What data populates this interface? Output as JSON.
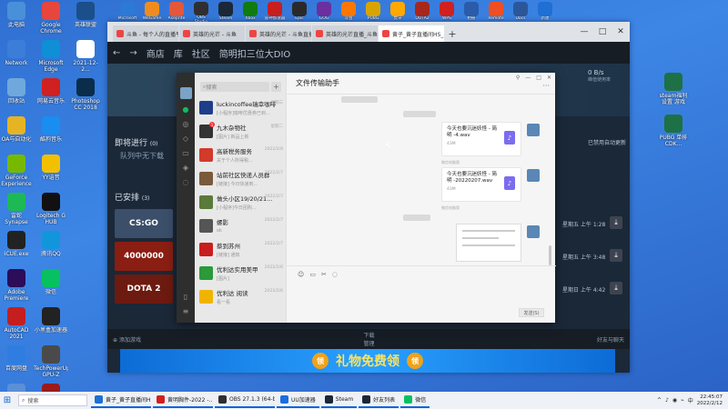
{
  "desktop": {
    "left_col1": [
      {
        "label": "此电脑",
        "icon": "computer-icon",
        "color": "#4a90d9"
      },
      {
        "label": "Network",
        "icon": "network-icon",
        "color": "#3b7dd8"
      },
      {
        "label": "回收站",
        "icon": "recycle-bin-icon",
        "color": "#6fa8dc"
      },
      {
        "label": "OA与自动化",
        "icon": "folder-icon",
        "color": "#e6b422"
      },
      {
        "label": "GeForce Experience",
        "icon": "nvidia-icon",
        "color": "#76b900"
      },
      {
        "label": "雷蛇Synapse",
        "icon": "razer-icon",
        "color": "#1db954"
      },
      {
        "label": "iCUE.exe",
        "icon": "icue-icon",
        "color": "#222222"
      },
      {
        "label": "Adobe Premiere",
        "icon": "premiere-icon",
        "color": "#2b0d5a"
      },
      {
        "label": "AutoCAD 2021",
        "icon": "autocad-icon",
        "color": "#c41e1e"
      },
      {
        "label": "百度网盘",
        "icon": "baidu-icon",
        "color": "#2f7de1"
      },
      {
        "label": "20220812...",
        "icon": "image-file-icon",
        "color": "#5b8fd6"
      }
    ],
    "left_col2": [
      {
        "label": "Google Chrome",
        "icon": "chrome-icon",
        "color": "#e8453c"
      },
      {
        "label": "Microsoft Edge",
        "icon": "edge-icon",
        "color": "#0f8fd6"
      },
      {
        "label": "网易云音乐",
        "icon": "netease-music-icon",
        "color": "#d0201f"
      },
      {
        "label": "酷狗音乐",
        "icon": "kugou-icon",
        "color": "#1a8df0"
      },
      {
        "label": "YY语音",
        "icon": "yy-icon",
        "color": "#f3c000"
      },
      {
        "label": "Logitech G HUB",
        "icon": "logitech-icon",
        "color": "#111111"
      },
      {
        "label": "腾讯QQ",
        "icon": "qq-icon",
        "color": "#1296db"
      },
      {
        "label": "微信",
        "icon": "wechat-icon",
        "color": "#07c160"
      },
      {
        "label": "小黑盒加速器",
        "icon": "accelerator-icon",
        "color": "#222222"
      },
      {
        "label": "TechPowerUp GPU-Z",
        "icon": "gpuz-icon",
        "color": "#4a4a4a"
      },
      {
        "label": "MSI Afterburner",
        "icon": "afterburner-icon",
        "color": "#9c1a1a"
      }
    ],
    "left_col3": [
      {
        "label": "英雄联盟",
        "icon": "lol-icon",
        "color": "#1b4f8a"
      },
      {
        "label": "2021-12-2...",
        "icon": "file-icon",
        "color": "#ffffff"
      },
      {
        "label": "Photoshop CC 2018",
        "icon": "photoshop-icon",
        "color": "#0b2c4a"
      }
    ],
    "top_strip": [
      {
        "label": "Microsoft",
        "icon": "ms-icon",
        "color": "#2c79d6"
      },
      {
        "label": "WeGame",
        "icon": "wegame-icon",
        "color": "#f08c1e"
      },
      {
        "label": "Aseprite",
        "icon": "aseprite-icon",
        "color": "#e4573a"
      },
      {
        "label": "OBS Studio",
        "icon": "obs-icon",
        "color": "#302e31"
      },
      {
        "label": "Steam",
        "icon": "steam-icon",
        "color": "#1b2838"
      },
      {
        "label": "Xbox",
        "icon": "xbox-icon",
        "color": "#107c10"
      },
      {
        "label": "雷神加速器",
        "icon": "leishen-icon",
        "color": "#c81e1e"
      },
      {
        "label": "Epic",
        "icon": "epic-icon",
        "color": "#2a2a2a"
      },
      {
        "label": "GOG",
        "icon": "gog-icon",
        "color": "#6b2fa0"
      },
      {
        "label": "斗鱼",
        "icon": "douyu-icon",
        "color": "#ff7700"
      },
      {
        "label": "PUBG",
        "icon": "pubg-icon",
        "color": "#d9a400"
      },
      {
        "label": "虎牙",
        "icon": "huya-icon",
        "color": "#ffa800"
      },
      {
        "label": "DOTA2",
        "icon": "dota-icon",
        "color": "#a8271b"
      },
      {
        "label": "WPS",
        "icon": "wps-icon",
        "color": "#d0201f"
      },
      {
        "label": "相册",
        "icon": "photos-icon",
        "color": "#2a5caa"
      },
      {
        "label": "Remote",
        "icon": "remote-icon",
        "color": "#f04e23"
      },
      {
        "label": "Docs",
        "icon": "doc-icon",
        "color": "#2b579a"
      },
      {
        "label": "新建",
        "icon": "new-doc-icon",
        "color": "#1f6fd4"
      }
    ],
    "right_col": [
      {
        "label": "steam福利 设置 游戏",
        "icon": "excel-icon",
        "color": "#1d7144"
      },
      {
        "label": "PUBG 单排 CDK...",
        "icon": "excel-icon",
        "color": "#1d7144"
      }
    ]
  },
  "browser": {
    "tabs": [
      {
        "title": "斗鱼 - 每个人的直播平台",
        "active": false
      },
      {
        "title": "英雄的光芒 - 斗鱼",
        "active": false
      },
      {
        "title": "英雄的光芒 - 斗鱼直播",
        "active": false
      },
      {
        "title": "英雄的光芒直播_斗鱼",
        "active": false
      },
      {
        "title": "黄子_黄子直播间HS_斗鱼",
        "active": true
      }
    ],
    "new_tab": "+",
    "win_controls": [
      "—",
      "□",
      "✕"
    ]
  },
  "steam": {
    "nav": [
      "←",
      "→",
      "商店",
      "库",
      "社区",
      "简明扣三位大DIO"
    ],
    "in_progress_title": "即将进行",
    "in_progress_count": "(0)",
    "queue_empty": "队列中无下载",
    "scheduled_title": "已安排",
    "scheduled_count": "(3)",
    "stats": "0 B/s",
    "stats_sub": "峰值使用率",
    "hint": "已禁用自动更新",
    "games": [
      {
        "name": "CS:GO",
        "color": "#3b4f6a",
        "date": "星期五 上午 1:28"
      },
      {
        "name": "4000000",
        "color": "#8a1e12",
        "date": "星期五 上午 3:48"
      },
      {
        "name": "DOTA 2",
        "color": "#6d1a10",
        "date": "星期日 上午 4:42"
      }
    ],
    "add_game": "添加游戏",
    "downloads_label": "下载",
    "downloads_sub": "管理",
    "friends_label": "好友与聊天"
  },
  "ad": {
    "text": "礼物免费领"
  },
  "wechat": {
    "search_placeholder": "搜索",
    "chats": [
      {
        "name": "luckincoffee瑞幸咖啡",
        "preview": "[小程序]咖啡优惠券已到...",
        "time": "星期三",
        "color": "#1f3e8a",
        "badge": ""
      },
      {
        "name": "九木杂物社",
        "preview": "[图片] 新品上新",
        "time": "星期二",
        "color": "#333333",
        "badge": "1"
      },
      {
        "name": "高新税务服务",
        "preview": "关于个人所得税...",
        "time": "2022/2/8",
        "color": "#d23a2a",
        "badge": ""
      },
      {
        "name": "站前社区快递人员群",
        "preview": "[链接] 今日快递到...",
        "time": "2022/2/7",
        "color": "#7a5a3a",
        "badge": ""
      },
      {
        "name": "做头小区19/20/21...",
        "preview": "[小程序]今日团购...",
        "time": "2022/2/7",
        "color": "#5a7a3a",
        "badge": ""
      },
      {
        "name": "螺影",
        "preview": "ok",
        "time": "2022/2/7",
        "color": "#555555",
        "badge": ""
      },
      {
        "name": "蔡到苏州",
        "preview": "[链接] 通知",
        "time": "2022/2/7",
        "color": "#c81e1e",
        "badge": ""
      },
      {
        "name": "优利达实用美甲",
        "preview": "[图片]",
        "time": "2022/2/6",
        "color": "#2a9a3a",
        "badge": ""
      },
      {
        "name": "优利达 阅读",
        "preview": "看一看",
        "time": "2022/2/6",
        "color": "#f0b400",
        "badge": ""
      }
    ],
    "chat_title": "文件传输助手",
    "messages": [
      {
        "file": "今天也要沉迷妖怪 - 简明 -4.wav",
        "size": "43M",
        "src": "微信电脑版"
      },
      {
        "file": "今天也要沉迷妖怪 - 简明 -20220207.wav",
        "size": "43M",
        "src": "微信电脑版"
      }
    ],
    "send_label": "发送(S)",
    "toolbar": [
      "☺",
      "▭",
      "✂",
      "◌"
    ],
    "window_controls": [
      "⚲",
      "—",
      "□",
      "✕"
    ],
    "more": "···"
  },
  "taskbar": {
    "search_placeholder": "搜索",
    "apps": [
      {
        "label": "黄子_黄子直播间HS...",
        "color": "#1f6fd4"
      },
      {
        "label": "黄明胸件-2022 -...",
        "color": "#d0201f"
      },
      {
        "label": "OBS 27.1.3 (64-bi...",
        "color": "#302e31"
      },
      {
        "label": "UU加速器",
        "color": "#1b6ee0"
      },
      {
        "label": "Steam",
        "color": "#1b2838"
      },
      {
        "label": "好友列表",
        "color": "#1b2838"
      },
      {
        "label": "微信",
        "color": "#07c160"
      }
    ],
    "time": "22:45:07",
    "date": "2022/2/12",
    "ime": "中",
    "tray_icons": [
      "^",
      "♪",
      "◉",
      "⌁"
    ]
  }
}
